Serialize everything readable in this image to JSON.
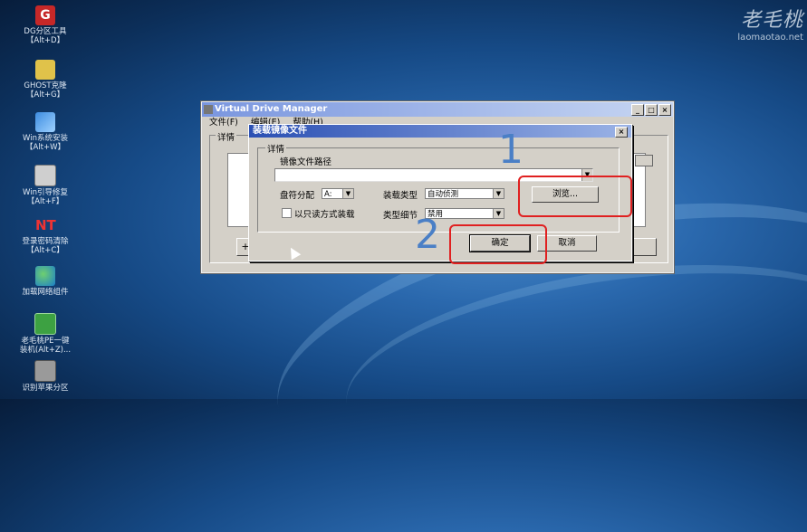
{
  "desktop": {
    "icons": [
      {
        "id": "dg",
        "label": "DG分区工具\n【Alt+D】",
        "glyph": "G"
      },
      {
        "id": "ghost",
        "label": "GHOST克隆\n【Alt+G】",
        "glyph": ""
      },
      {
        "id": "win",
        "label": "Win系统安装\n【Alt+W】",
        "glyph": ""
      },
      {
        "id": "winboot",
        "label": "Win引导修复\n【Alt+F】",
        "glyph": ""
      },
      {
        "id": "ntpwd",
        "label": "登录密码清除\n【Alt+C】",
        "glyph": "NT"
      },
      {
        "id": "net",
        "label": "加载网络组件",
        "glyph": ""
      },
      {
        "id": "pe",
        "label": "老毛桃PE一键\n装机(Alt+Z)...",
        "glyph": ""
      },
      {
        "id": "usb",
        "label": "识别苹果分区",
        "glyph": ""
      }
    ],
    "brand_big": "老毛桃",
    "brand_small": "laomaotao.net"
  },
  "main_window": {
    "title": "Virtual Drive Manager",
    "menu": [
      "文件(F)",
      "编辑(E)",
      "帮助(H)"
    ],
    "group_label": "详情",
    "add_button": "+",
    "buttons": {
      "minimize": "_",
      "maximize": "□",
      "close": "×"
    }
  },
  "dialog": {
    "title": "装载镜像文件",
    "close": "×",
    "group_label": "详情",
    "path_label": "镜像文件路径",
    "path_value": "",
    "drive_label": "盘符分配",
    "drive_value": "A:",
    "mount_type_label": "装载类型",
    "mount_type_value": "自动侦测",
    "readonly_label": "以只读方式装载",
    "readonly_checked": false,
    "type_detail_label": "类型细节",
    "type_detail_value": "禁用",
    "browse_button": "浏览...",
    "ok_button": "确定",
    "cancel_button": "取消"
  },
  "annotations": {
    "step1": "1",
    "step2": "2",
    "highlight_color": "#e02020",
    "number_color": "#4a7fc6"
  }
}
